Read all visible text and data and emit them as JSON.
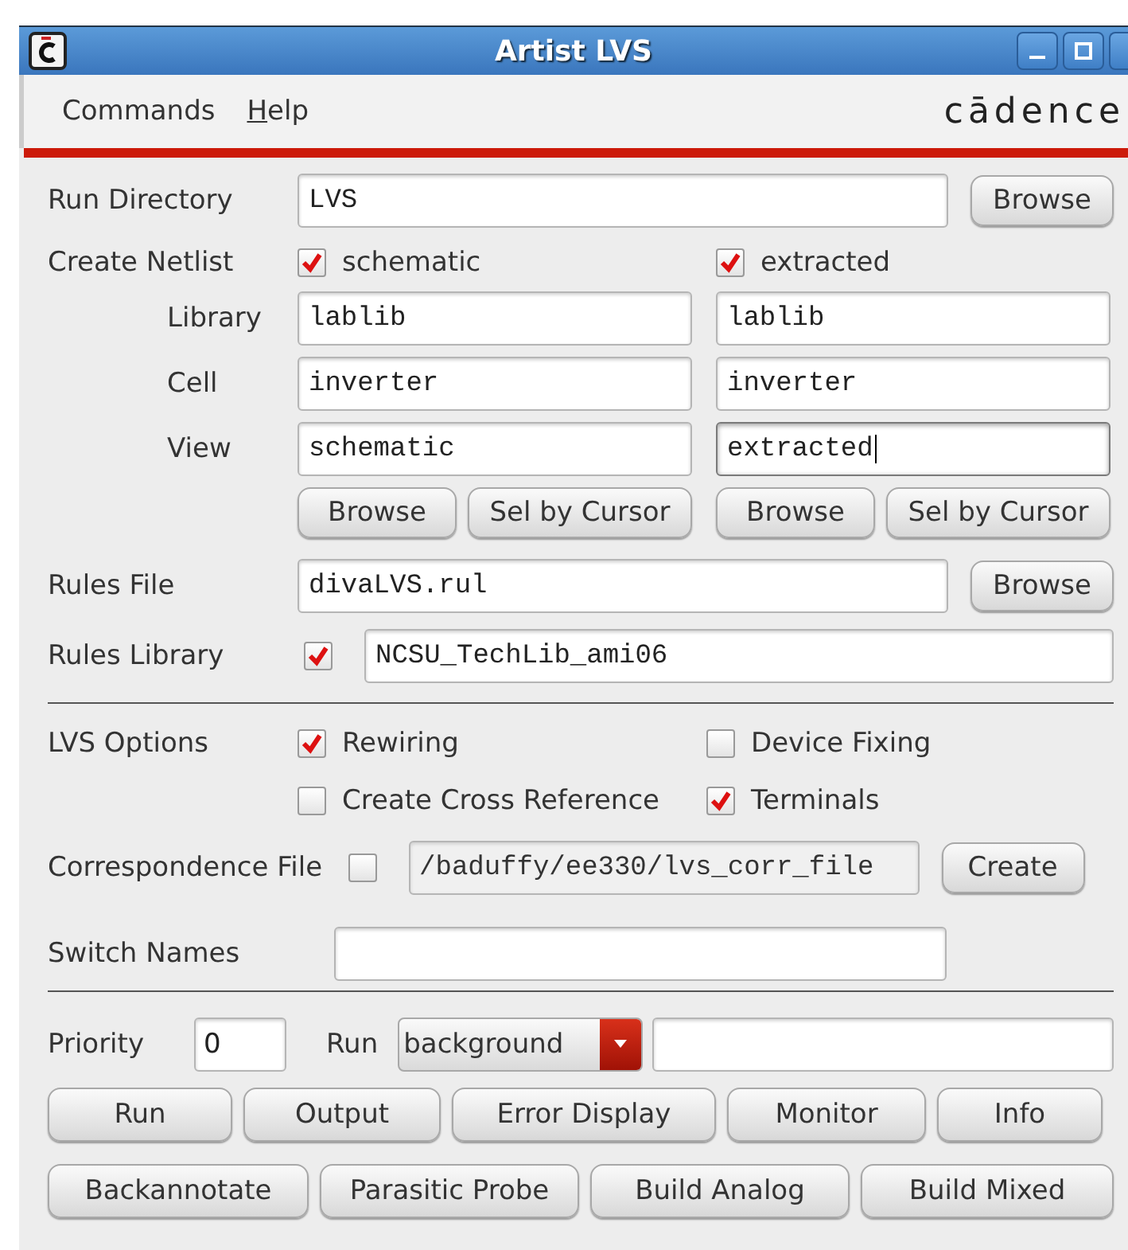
{
  "window": {
    "title": "Artist LVS"
  },
  "menu": [
    {
      "label": "Commands",
      "mnemonic": false
    },
    {
      "label": "Help",
      "mnemonic": true
    }
  ],
  "logo": "cādence",
  "run_directory": {
    "label": "Run Directory",
    "value": "LVS",
    "button": "Browse"
  },
  "create_netlist": {
    "label": "Create Netlist",
    "field_labels": [
      "Library",
      "Cell",
      "View"
    ],
    "columns": [
      {
        "label": "schematic",
        "checked": true,
        "values": [
          "lablib",
          "inverter",
          "schematic"
        ],
        "focused": false,
        "buttons": [
          "Browse",
          "Sel by Cursor"
        ]
      },
      {
        "label": "extracted",
        "checked": true,
        "values": [
          "lablib",
          "inverter",
          "extracted"
        ],
        "focused": true,
        "buttons": [
          "Browse",
          "Sel by Cursor"
        ]
      }
    ]
  },
  "rules_file": {
    "label": "Rules File",
    "value": "divaLVS.rul",
    "button": "Browse"
  },
  "rules_library": {
    "label": "Rules Library",
    "checked": true,
    "value": "NCSU_TechLib_ami06"
  },
  "lvs_options": {
    "label": "LVS Options",
    "options": [
      {
        "label": "Rewiring",
        "checked": true
      },
      {
        "label": "Device Fixing",
        "checked": false
      },
      {
        "label": "Create Cross Reference",
        "checked": false
      },
      {
        "label": "Terminals",
        "checked": true
      }
    ]
  },
  "correspondence_file": {
    "label": "Correspondence File",
    "checked": false,
    "value": "/baduffy/ee330/lvs_corr_file",
    "disabled": true,
    "button": "Create"
  },
  "switch_names": {
    "label": "Switch Names"
  },
  "priority": {
    "label": "Priority",
    "value": "0"
  },
  "run_mode": {
    "label": "Run",
    "value": "background"
  },
  "actions": [
    [
      "Run",
      "Output",
      "Error Display",
      "Monitor",
      "Info"
    ],
    [
      "Backannotate",
      "Parasitic Probe",
      "Build Analog",
      "Build Mixed"
    ]
  ]
}
